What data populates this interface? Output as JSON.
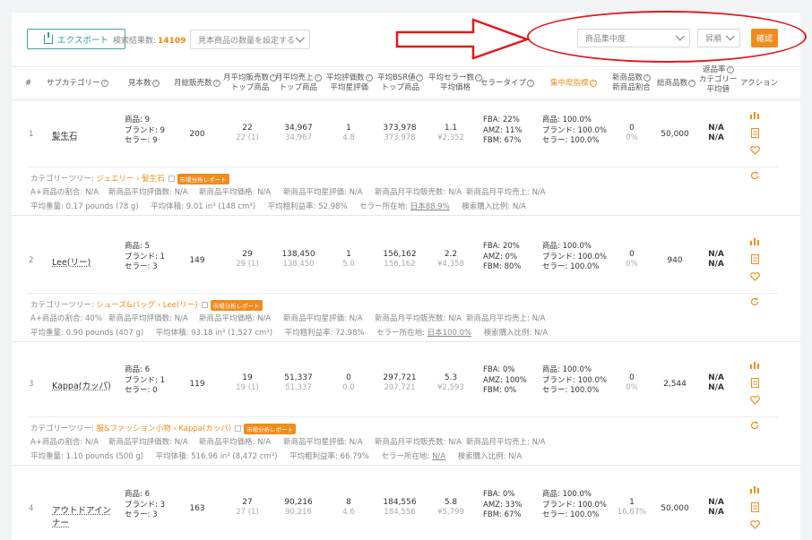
{
  "toolbar": {
    "export_label": "エクスポート",
    "result_label": "検索結果数:",
    "result_count": "14109",
    "qty_select": "見本商品の数量を設定する",
    "sort_field": "商品集中度",
    "sort_order": "昇順",
    "confirm_label": "確認"
  },
  "columns": {
    "no": "#",
    "subcategory": "サブカテゴリー",
    "sample": "見本数",
    "monthly_sales": "月総販売数",
    "avg_sales_1": "月平均販売数",
    "avg_sales_2": "トップ商品",
    "avg_revenue_1": "月平均売上",
    "avg_revenue_2": "トップ商品",
    "avg_reviews_1": "平均評価数",
    "avg_reviews_2": "平均星評価",
    "avg_bsr_1": "平均BSR値",
    "avg_bsr_2": "トップ商品",
    "avg_sellers_1": "平均セラー数",
    "avg_sellers_2": "平均価格",
    "seller_type": "セラータイプ",
    "concentration": "集中度指標",
    "new_items_1": "新商品数",
    "new_items_2": "新商品割合",
    "total_items": "総商品数",
    "return_1": "返品率",
    "return_2": "カテゴリー",
    "return_3": "平均値",
    "action": "アクション"
  },
  "rows": [
    {
      "index": "1",
      "name": "髪生石",
      "sample": [
        "商品: 9",
        "ブランド: 9",
        "セラー: 9"
      ],
      "monthly_sales": "200",
      "avg_sales": "22",
      "avg_sales_top": "22 (1)",
      "avg_revenue": "34,967",
      "avg_revenue_top": "34,967",
      "reviews": "1",
      "stars": "4.8",
      "bsr": "373,978",
      "bsr_top": "373,978",
      "sellers": "1.1",
      "price": "¥2,352",
      "seller_type": [
        "FBA: 22%",
        "AMZ: 11%",
        "FBM: 67%"
      ],
      "concentration": [
        "商品: 100.0%",
        "ブランド: 100.0%",
        "セラー: 100.0%"
      ],
      "new_items": "0",
      "new_ratio": "0%",
      "total": "50,000",
      "return": "N/A",
      "return_avg": "N/A",
      "tree_label": "カテゴリーツリー:",
      "tree_path": "ジュエリー › 髪生石",
      "badge": "市場分析レポート",
      "meta1": [
        "A+商品の割合: N/A",
        "新商品平均評価数: N/A",
        "新商品平均価格: N/A",
        "新商品平均星評価: N/A",
        "新商品月平均販売数: N/A",
        "新商品月平均売上: N/A"
      ],
      "meta2_weight": "平均重量: 0.17 pounds (78 g)",
      "meta2_volume": "平均体積: 9.01 in³ (148 cm³)",
      "meta2_margin": "平均粗利益率: 52.98%",
      "meta2_origin_label": "セラー所在地:",
      "meta2_origin": "日本88.9%",
      "meta2_buy": "検索購入比例: N/A"
    },
    {
      "index": "2",
      "name": "Lee(リー)",
      "sample": [
        "商品: 5",
        "ブランド: 1",
        "セラー: 3"
      ],
      "monthly_sales": "149",
      "avg_sales": "29",
      "avg_sales_top": "29 (1)",
      "avg_revenue": "138,450",
      "avg_revenue_top": "138,450",
      "reviews": "1",
      "stars": "5.0",
      "bsr": "156,162",
      "bsr_top": "156,162",
      "sellers": "2.2",
      "price": "¥4,358",
      "seller_type": [
        "FBA: 20%",
        "AMZ: 0%",
        "FBM: 80%"
      ],
      "concentration": [
        "商品: 100.0%",
        "ブランド: 100.0%",
        "セラー: 100.0%"
      ],
      "new_items": "0",
      "new_ratio": "0%",
      "total": "940",
      "return": "N/A",
      "return_avg": "N/A",
      "tree_label": "カテゴリーツリー:",
      "tree_path": "シューズ&バッグ › Lee(リー)",
      "badge": "市場分析レポート",
      "meta1": [
        "A+商品の割合: 40%",
        "新商品平均評価数: N/A",
        "新商品平均価格: N/A",
        "新商品平均星評価: N/A",
        "新商品月平均販売数: N/A",
        "新商品月平均売上: N/A"
      ],
      "meta2_weight": "平均重量: 0.90 pounds (407 g)",
      "meta2_volume": "平均体積: 93.18 in³ (1,527 cm³)",
      "meta2_margin": "平均粗利益率: 72.98%",
      "meta2_origin_label": "セラー所在地:",
      "meta2_origin": "日本100.0%",
      "meta2_buy": "検索購入比例: N/A"
    },
    {
      "index": "3",
      "name": "Kappa(カッパ)",
      "sample": [
        "商品: 6",
        "ブランド: 1",
        "セラー: 0"
      ],
      "monthly_sales": "119",
      "avg_sales": "19",
      "avg_sales_top": "19 (1)",
      "avg_revenue": "51,337",
      "avg_revenue_top": "51,337",
      "reviews": "0",
      "stars": "0.0",
      "bsr": "297,721",
      "bsr_top": "297,721",
      "sellers": "5.3",
      "price": "¥2,593",
      "seller_type": [
        "FBA: 0%",
        "AMZ: 100%",
        "FBM: 0%"
      ],
      "concentration": [
        "商品: 100.0%",
        "ブランド: 100.0%",
        "セラー: 100.0%"
      ],
      "new_items": "0",
      "new_ratio": "0%",
      "total": "2,544",
      "return": "N/A",
      "return_avg": "N/A",
      "tree_label": "カテゴリーツリー:",
      "tree_path": "服&ファッション小物 › Kappa(カッパ)",
      "badge": "市場分析レポート",
      "meta1": [
        "A+商品の割合: N/A",
        "新商品平均評価数: N/A",
        "新商品平均価格: N/A",
        "新商品平均星評価: N/A",
        "新商品月平均販売数: N/A",
        "新商品月平均売上: N/A"
      ],
      "meta2_weight": "平均重量: 1.10 pounds (500 g)",
      "meta2_volume": "平均体積: 516.96 in³ (8,472 cm³)",
      "meta2_margin": "平均粗利益率: 66.79%",
      "meta2_origin_label": "セラー所在地:",
      "meta2_origin": "N/A",
      "meta2_buy": "検索購入比例: N/A"
    },
    {
      "index": "4",
      "name": "アウトドアインナー",
      "sample": [
        "商品: 6",
        "ブランド: 3",
        "セラー: 3"
      ],
      "monthly_sales": "163",
      "avg_sales": "27",
      "avg_sales_top": "27 (1)",
      "avg_revenue": "90,216",
      "avg_revenue_top": "90,216",
      "reviews": "8",
      "stars": "4.6",
      "bsr": "184,556",
      "bsr_top": "184,556",
      "sellers": "5.8",
      "price": "¥5,799",
      "seller_type": [
        "FBA: 0%",
        "AMZ: 33%",
        "FBM: 67%"
      ],
      "concentration": [
        "商品: 100.0%",
        "ブランド: 100.0%",
        "セラー: 100.0%"
      ],
      "new_items": "1",
      "new_ratio": "16.67%",
      "total": "50,000",
      "return": "N/A",
      "return_avg": "N/A"
    }
  ],
  "colors": {
    "accent": "#f08c1c",
    "export": "#2c9a93",
    "annotation": "#e21a1a"
  }
}
